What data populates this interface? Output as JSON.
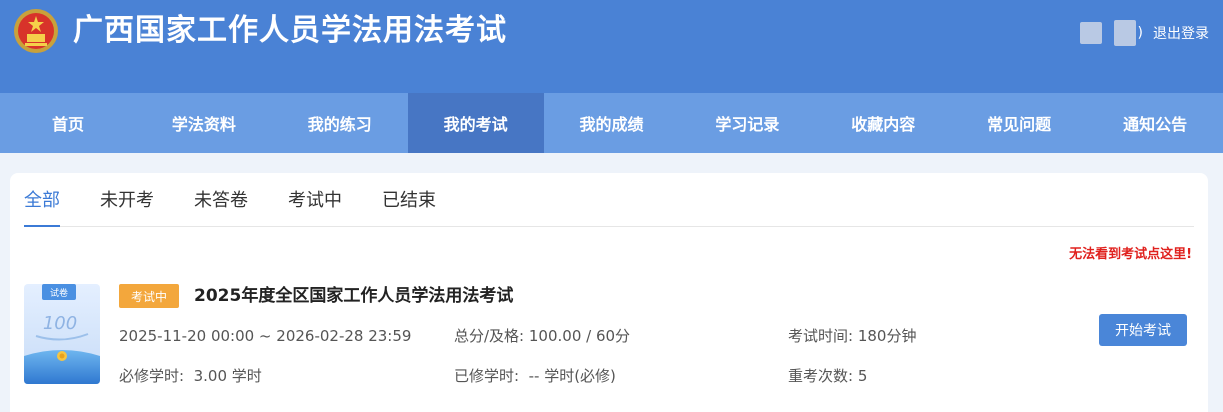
{
  "header": {
    "title": "广西国家工作人员学法用法考试",
    "user_paren": ")",
    "logout_label": "退出登录",
    "emblem_icon": "national-emblem-icon"
  },
  "nav": {
    "items": [
      {
        "label": "首页"
      },
      {
        "label": "学法资料"
      },
      {
        "label": "我的练习"
      },
      {
        "label": "我的考试"
      },
      {
        "label": "我的成绩"
      },
      {
        "label": "学习记录"
      },
      {
        "label": "收藏内容"
      },
      {
        "label": "常见问题"
      },
      {
        "label": "通知公告"
      }
    ],
    "active_index": 3
  },
  "tabs": {
    "items": [
      {
        "label": "全部"
      },
      {
        "label": "未开考"
      },
      {
        "label": "未答卷"
      },
      {
        "label": "考试中"
      },
      {
        "label": "已结束"
      }
    ],
    "active_index": 0
  },
  "notice": "无法看到考试点这里!",
  "exam": {
    "paper_tag": "试卷",
    "paper_score": "100",
    "status": "考试中",
    "title": "2025年度全区国家工作人员学法用法考试",
    "time_range": "2025-11-20 00:00 ~ 2026-02-28 23:59",
    "score_label": "总分/及格:",
    "score_value": "100.00 / 60分",
    "duration_label": "考试时间:",
    "duration_value": "180分钟",
    "required_label": "必修学时:",
    "required_value": "3.00 学时",
    "completed_label": "已修学时:",
    "completed_value": "-- 学时(必修)",
    "retake_label": "重考次数:",
    "retake_value": "5",
    "start_label": "开始考试"
  },
  "colors": {
    "header": "#4a82d5",
    "nav": "#6a9de3",
    "nav_active": "#4776c4",
    "accent": "#3b7ad6",
    "status_badge": "#f3a73c",
    "notice": "#e0211e"
  }
}
